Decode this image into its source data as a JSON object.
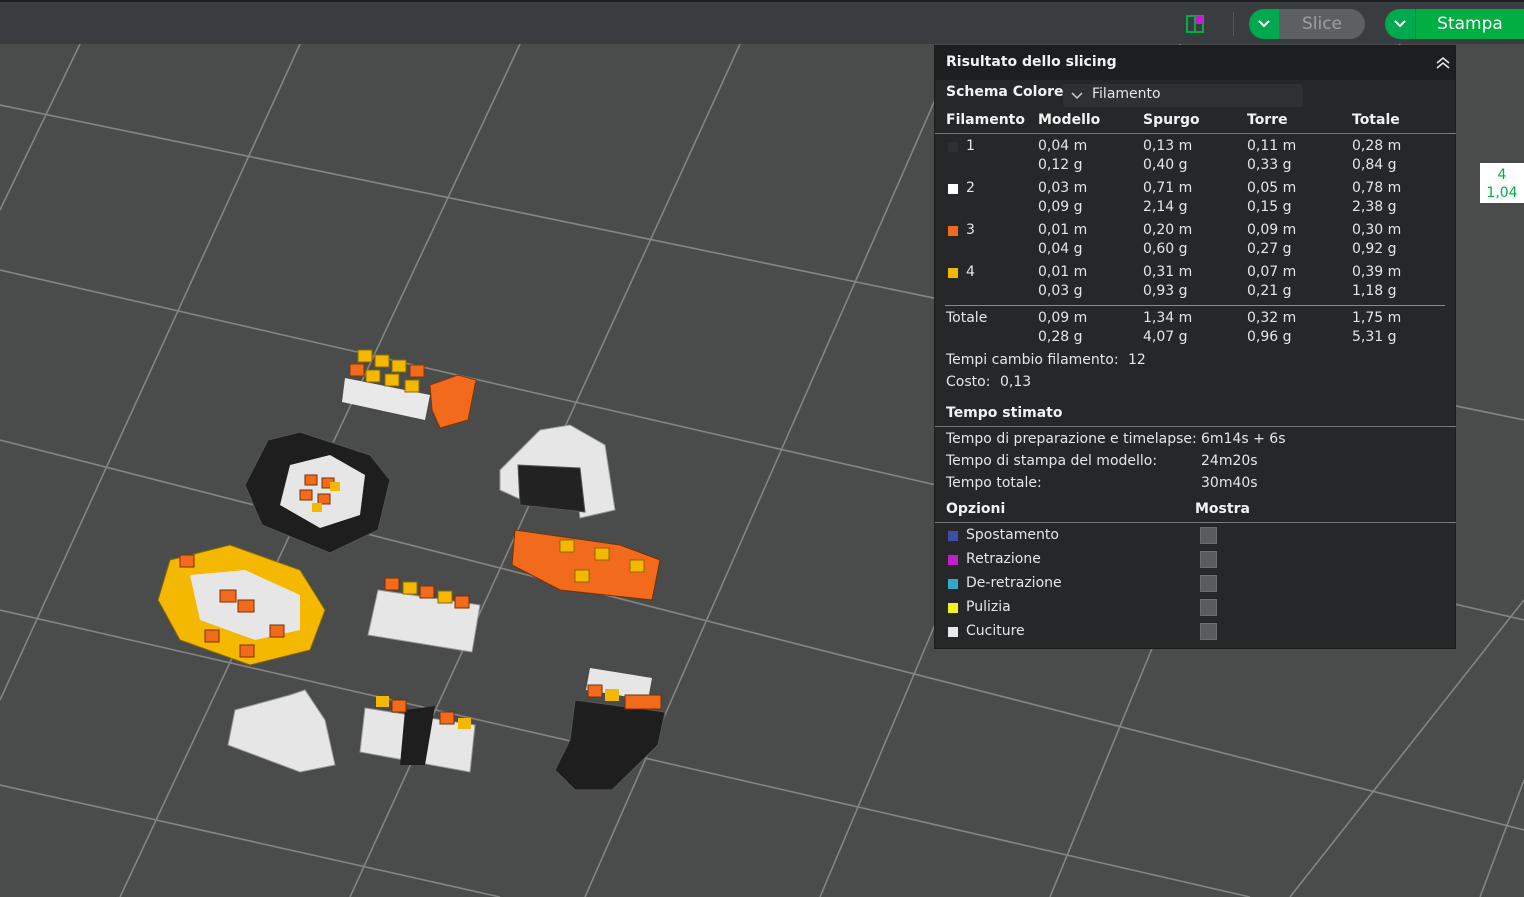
{
  "toolbar": {
    "layout_icon": "split-view-icon",
    "slice_label": "Slice",
    "print_label": "Stampa",
    "colors": {
      "accent": "#00ae42"
    }
  },
  "panel": {
    "title": "Risultato dello slicing",
    "scheme_label": "Schema Colore",
    "scheme_value": "Filamento",
    "columns": [
      "Filamento",
      "Modello",
      "Spurgo",
      "Torre",
      "Totale"
    ],
    "rows": [
      {
        "id": "1",
        "color": "#303030",
        "model_m": "0,04 m",
        "model_g": "0,12 g",
        "purge_m": "0,13 m",
        "purge_g": "0,40 g",
        "tower_m": "0,11 m",
        "tower_g": "0,33 g",
        "total_m": "0,28 m",
        "total_g": "0,84 g"
      },
      {
        "id": "2",
        "color": "#ffffff",
        "model_m": "0,03 m",
        "model_g": "0,09 g",
        "purge_m": "0,71 m",
        "purge_g": "2,14 g",
        "tower_m": "0,05 m",
        "tower_g": "0,15 g",
        "total_m": "0,78 m",
        "total_g": "2,38 g"
      },
      {
        "id": "3",
        "color": "#f26a1b",
        "model_m": "0,01 m",
        "model_g": "0,04 g",
        "purge_m": "0,20 m",
        "purge_g": "0,60 g",
        "tower_m": "0,09 m",
        "tower_g": "0,27 g",
        "total_m": "0,30 m",
        "total_g": "0,92 g"
      },
      {
        "id": "4",
        "color": "#f5b800",
        "model_m": "0,01 m",
        "model_g": "0,03 g",
        "purge_m": "0,31 m",
        "purge_g": "0,93 g",
        "tower_m": "0,07 m",
        "tower_g": "0,21 g",
        "total_m": "0,39 m",
        "total_g": "1,18 g"
      }
    ],
    "totals": {
      "label": "Totale",
      "model_m": "0,09 m",
      "model_g": "0,28 g",
      "purge_m": "1,34 m",
      "purge_g": "4,07 g",
      "tower_m": "0,32 m",
      "tower_g": "0,96 g",
      "total_m": "1,75 m",
      "total_g": "5,31 g"
    },
    "filament_changes_label": "Tempi cambio filamento:",
    "filament_changes_value": "12",
    "cost_label": "Costo:",
    "cost_value": "0,13",
    "time_section": "Tempo stimato",
    "prep_label": "Tempo di preparazione e timelapse:",
    "prep_value": "6m14s + 6s",
    "model_time_label": "Tempo di stampa del modello:",
    "model_time_value": "24m20s",
    "total_time_label": "Tempo totale:",
    "total_time_value": "30m40s",
    "options_label": "Opzioni",
    "show_label": "Mostra",
    "options": [
      {
        "label": "Spostamento",
        "color": "#3b4fa8"
      },
      {
        "label": "Retrazione",
        "color": "#c21fc9"
      },
      {
        "label": "De-retrazione",
        "color": "#2fa8c9"
      },
      {
        "label": "Pulizia",
        "color": "#f2f21a"
      },
      {
        "label": "Cuciture",
        "color": "#e8e8e8"
      }
    ]
  },
  "layer_badge": {
    "layer": "4",
    "height": "1,04"
  }
}
